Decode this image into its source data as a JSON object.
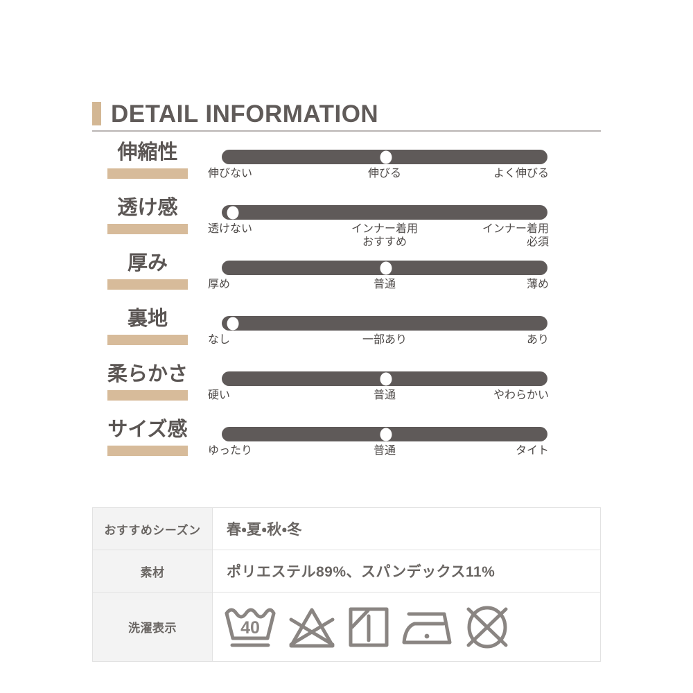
{
  "header": {
    "title": "DETAIL INFORMATION",
    "accent_color": "#d3b794"
  },
  "ratings": [
    {
      "label": "伸縮性",
      "position": "center",
      "ticks": {
        "left": "伸びない",
        "center": "伸びる",
        "right": "よく伸びる"
      }
    },
    {
      "label": "透け感",
      "position": "left",
      "ticks": {
        "left": "透けない",
        "center": "インナー着用\nおすすめ",
        "right": "インナー着用\n必須"
      }
    },
    {
      "label": "厚み",
      "position": "center",
      "ticks": {
        "left": "厚め",
        "center": "普通",
        "right": "薄め"
      }
    },
    {
      "label": "裏地",
      "position": "left",
      "ticks": {
        "left": "なし",
        "center": "一部あり",
        "right": "あり"
      }
    },
    {
      "label": "柔らかさ",
      "position": "center",
      "ticks": {
        "left": "硬い",
        "center": "普通",
        "right": "やわらかい"
      }
    },
    {
      "label": "サイズ感",
      "position": "center",
      "ticks": {
        "left": "ゆったり",
        "center": "普通",
        "right": "タイト"
      }
    }
  ],
  "spec_table": {
    "season": {
      "label": "おすすめシーズン",
      "value": "春・夏・秋・冬"
    },
    "material": {
      "label": "素材",
      "value": "ポリエステル89%、スパンデックス11%"
    },
    "care": {
      "label": "洗濯表示",
      "symbols": [
        "wash-tub-40-gentle-icon",
        "do-not-bleach-icon",
        "drip-dry-in-shade-icon",
        "iron-low-temperature-icon",
        "do-not-dryclean-icon"
      ]
    }
  },
  "colors": {
    "bar": "#5f5a59",
    "underline": "#d7bb9a",
    "text": "#5b5654",
    "table_header_bg": "#f3f3f3",
    "icon_stroke": "#8a8582"
  }
}
